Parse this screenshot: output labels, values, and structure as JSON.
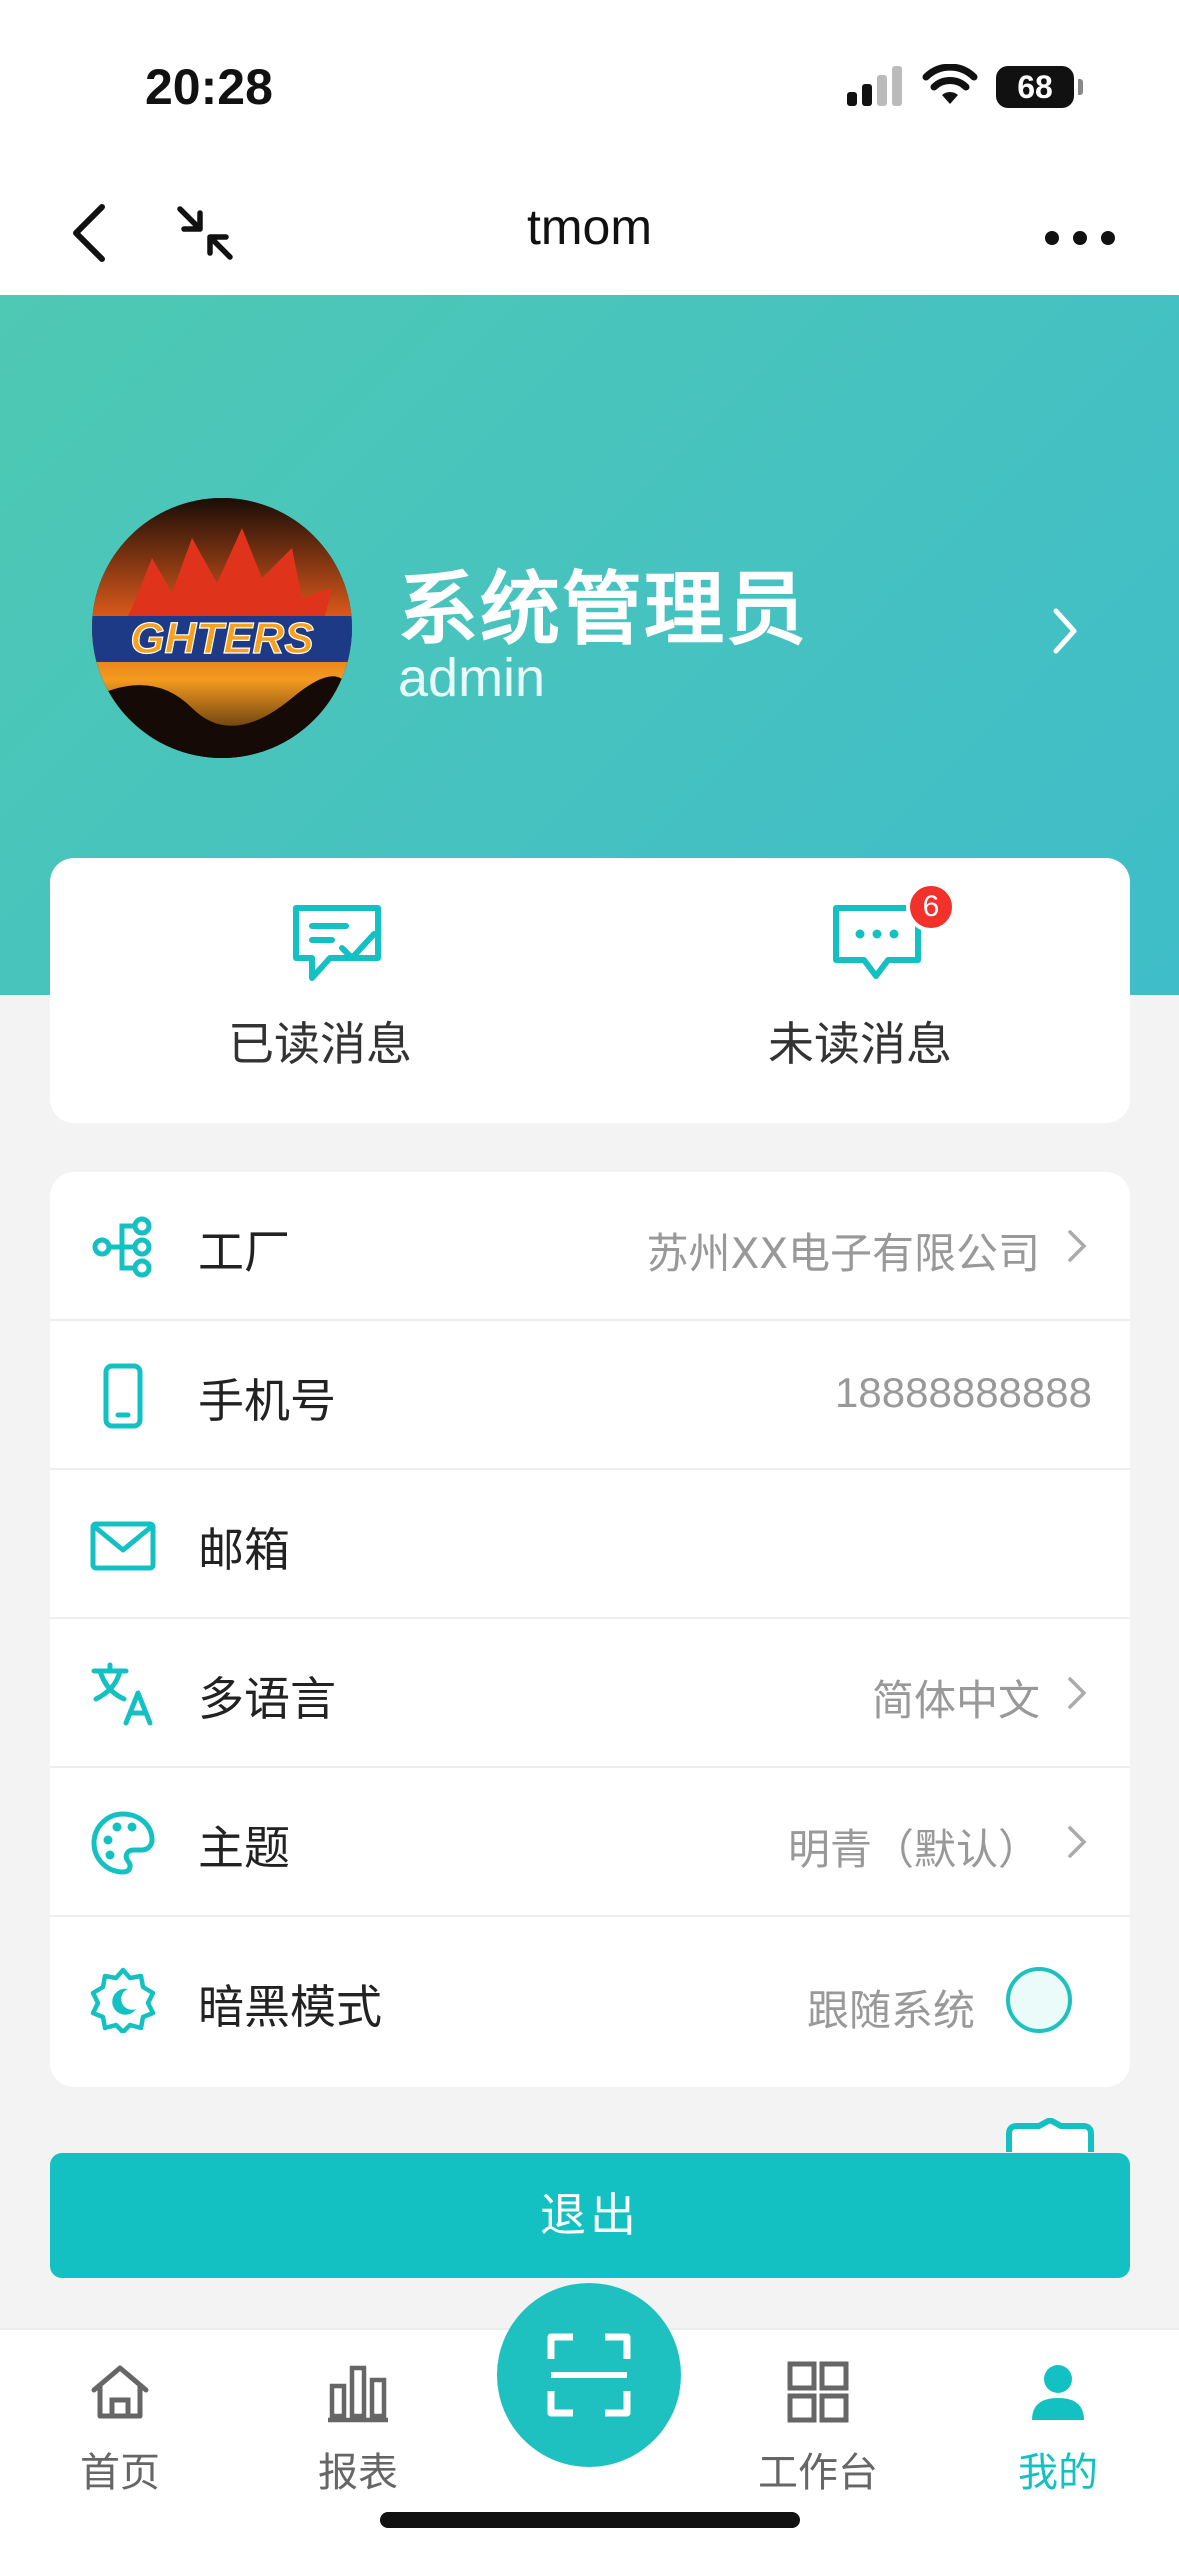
{
  "status_bar": {
    "time": "20:28",
    "battery": "68",
    "icons": [
      "signal-icon",
      "wifi-icon",
      "battery-icon"
    ]
  },
  "nav": {
    "title": "tmom",
    "icons": [
      "back-icon",
      "collapse-icon",
      "more-icon"
    ]
  },
  "profile": {
    "name": "系统管理员",
    "username": "admin",
    "avatar_text": "GHTERS"
  },
  "messages": {
    "read_label": "已读消息",
    "unread_label": "未读消息",
    "unread_count": "6"
  },
  "settings": {
    "factory": {
      "label": "工厂",
      "value": "苏州XX电子有限公司",
      "icon": "tree-icon"
    },
    "phone": {
      "label": "手机号",
      "value": "18888888888",
      "icon": "phone-icon"
    },
    "email": {
      "label": "邮箱",
      "value": "",
      "icon": "mail-icon"
    },
    "language": {
      "label": "多语言",
      "value": "简体中文",
      "icon": "translate-icon"
    },
    "theme": {
      "label": "主题",
      "value": "明青（默认）",
      "icon": "palette-icon"
    },
    "dark_mode": {
      "label": "暗黑模式",
      "value": "跟随系统",
      "icon": "moon-gear-icon"
    }
  },
  "logout_label": "退出",
  "tabbar": {
    "home": "首页",
    "reports": "报表",
    "workbench": "工作台",
    "mine": "我的",
    "active": "mine"
  },
  "colors": {
    "accent": "#14c1c2",
    "hero_start": "#4ec9b3",
    "hero_end": "#3fbdc8",
    "badge": "#f2312a"
  }
}
